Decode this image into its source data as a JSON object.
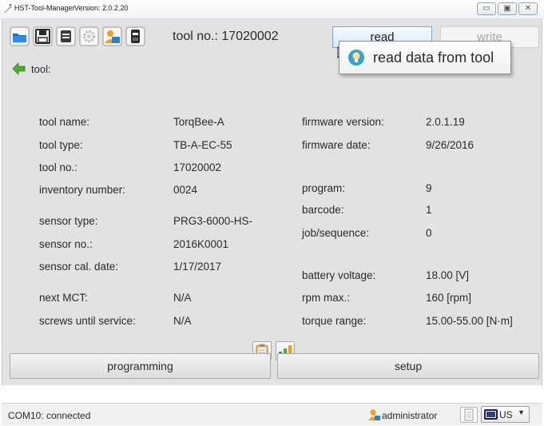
{
  "window": {
    "app_name": "HST-Tool-Manager",
    "version": "Version: 2.0.2.20"
  },
  "toolbar": {
    "tool_no_text": "tool no.: 17020002",
    "read_label": "read",
    "write_label": "write",
    "icons": [
      "folder-open-icon",
      "save-icon",
      "printer-icon",
      "settings-gear-icon",
      "user-icon",
      "device-icon"
    ]
  },
  "tool_row": {
    "label": "tool:"
  },
  "tooltip": {
    "text": "read data from tool"
  },
  "info_left": [
    {
      "label": "tool name:",
      "value": "TorqBee-A"
    },
    {
      "label": "tool type:",
      "value": "TB-A-EC-55"
    },
    {
      "label": "tool no.:",
      "value": "17020002"
    },
    {
      "label": "inventory number:",
      "value": "0024"
    },
    {
      "label": "sensor type:",
      "value": "PRG3-6000-HS-"
    },
    {
      "label": "sensor no.:",
      "value": "2016K0001"
    },
    {
      "label": "sensor cal. date:",
      "value": "1/17/2017"
    },
    {
      "label": "next MCT:",
      "value": "N/A"
    },
    {
      "label": "screws until service:",
      "value": "N/A"
    }
  ],
  "info_right": [
    {
      "label": "firmware version:",
      "value": "2.0.1.19"
    },
    {
      "label": "firmware date:",
      "value": "9/26/2016"
    },
    {
      "label": "program:",
      "value": "9"
    },
    {
      "label": "barcode:",
      "value": "1"
    },
    {
      "label": "job/sequence:",
      "value": "0"
    },
    {
      "label": "battery voltage:",
      "value": "18.00 [V]"
    },
    {
      "label": "rpm max.:",
      "value": "160 [rpm]"
    },
    {
      "label": "torque range:",
      "value": "15.00-55.00 [N·m]"
    }
  ],
  "buttons": {
    "programming": "programming",
    "setup": "setup"
  },
  "status": {
    "connection": "COM10: connected",
    "user": "administrator",
    "language": "US"
  },
  "colors": {
    "panel_bg": "#e2e2e2",
    "read_accent": "#d7e9f8",
    "icon_orange": "#f39c1f",
    "icon_blue": "#2f7fd0",
    "back_green": "#4caf2a"
  }
}
